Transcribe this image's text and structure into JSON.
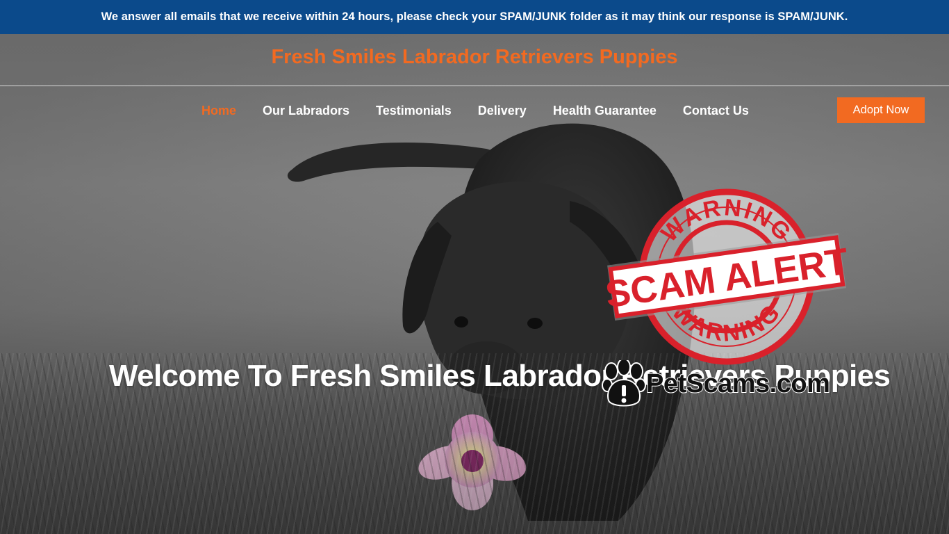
{
  "announcement": {
    "text": "We answer all emails that we receive within 24 hours, please check your SPAM/JUNK folder as it may think our response is SPAM/JUNK."
  },
  "header": {
    "site_title": "Fresh Smiles Labrador Retrievers Puppies"
  },
  "nav": {
    "items": [
      {
        "label": "Home",
        "active": true
      },
      {
        "label": "Our Labradors",
        "active": false
      },
      {
        "label": "Testimonials",
        "active": false
      },
      {
        "label": "Delivery",
        "active": false
      },
      {
        "label": "Health Guarantee",
        "active": false
      },
      {
        "label": "Contact Us",
        "active": false
      }
    ],
    "cta_label": "Adopt Now"
  },
  "hero": {
    "heading": "Welcome To Fresh Smiles Labrador Retrievers Puppies"
  },
  "overlay": {
    "stamp_top_text": "WARNING",
    "stamp_band_text": "SCAM ALERT",
    "stamp_bottom_text": "WARNING",
    "watermark_text": "PetScams.com"
  },
  "colors": {
    "announcement_bg": "#0b4a8b",
    "accent_orange": "#f26a21",
    "stamp_red": "#d9212b",
    "nav_text": "#ffffff"
  },
  "icons": {
    "paw": "paw-warning-icon"
  }
}
